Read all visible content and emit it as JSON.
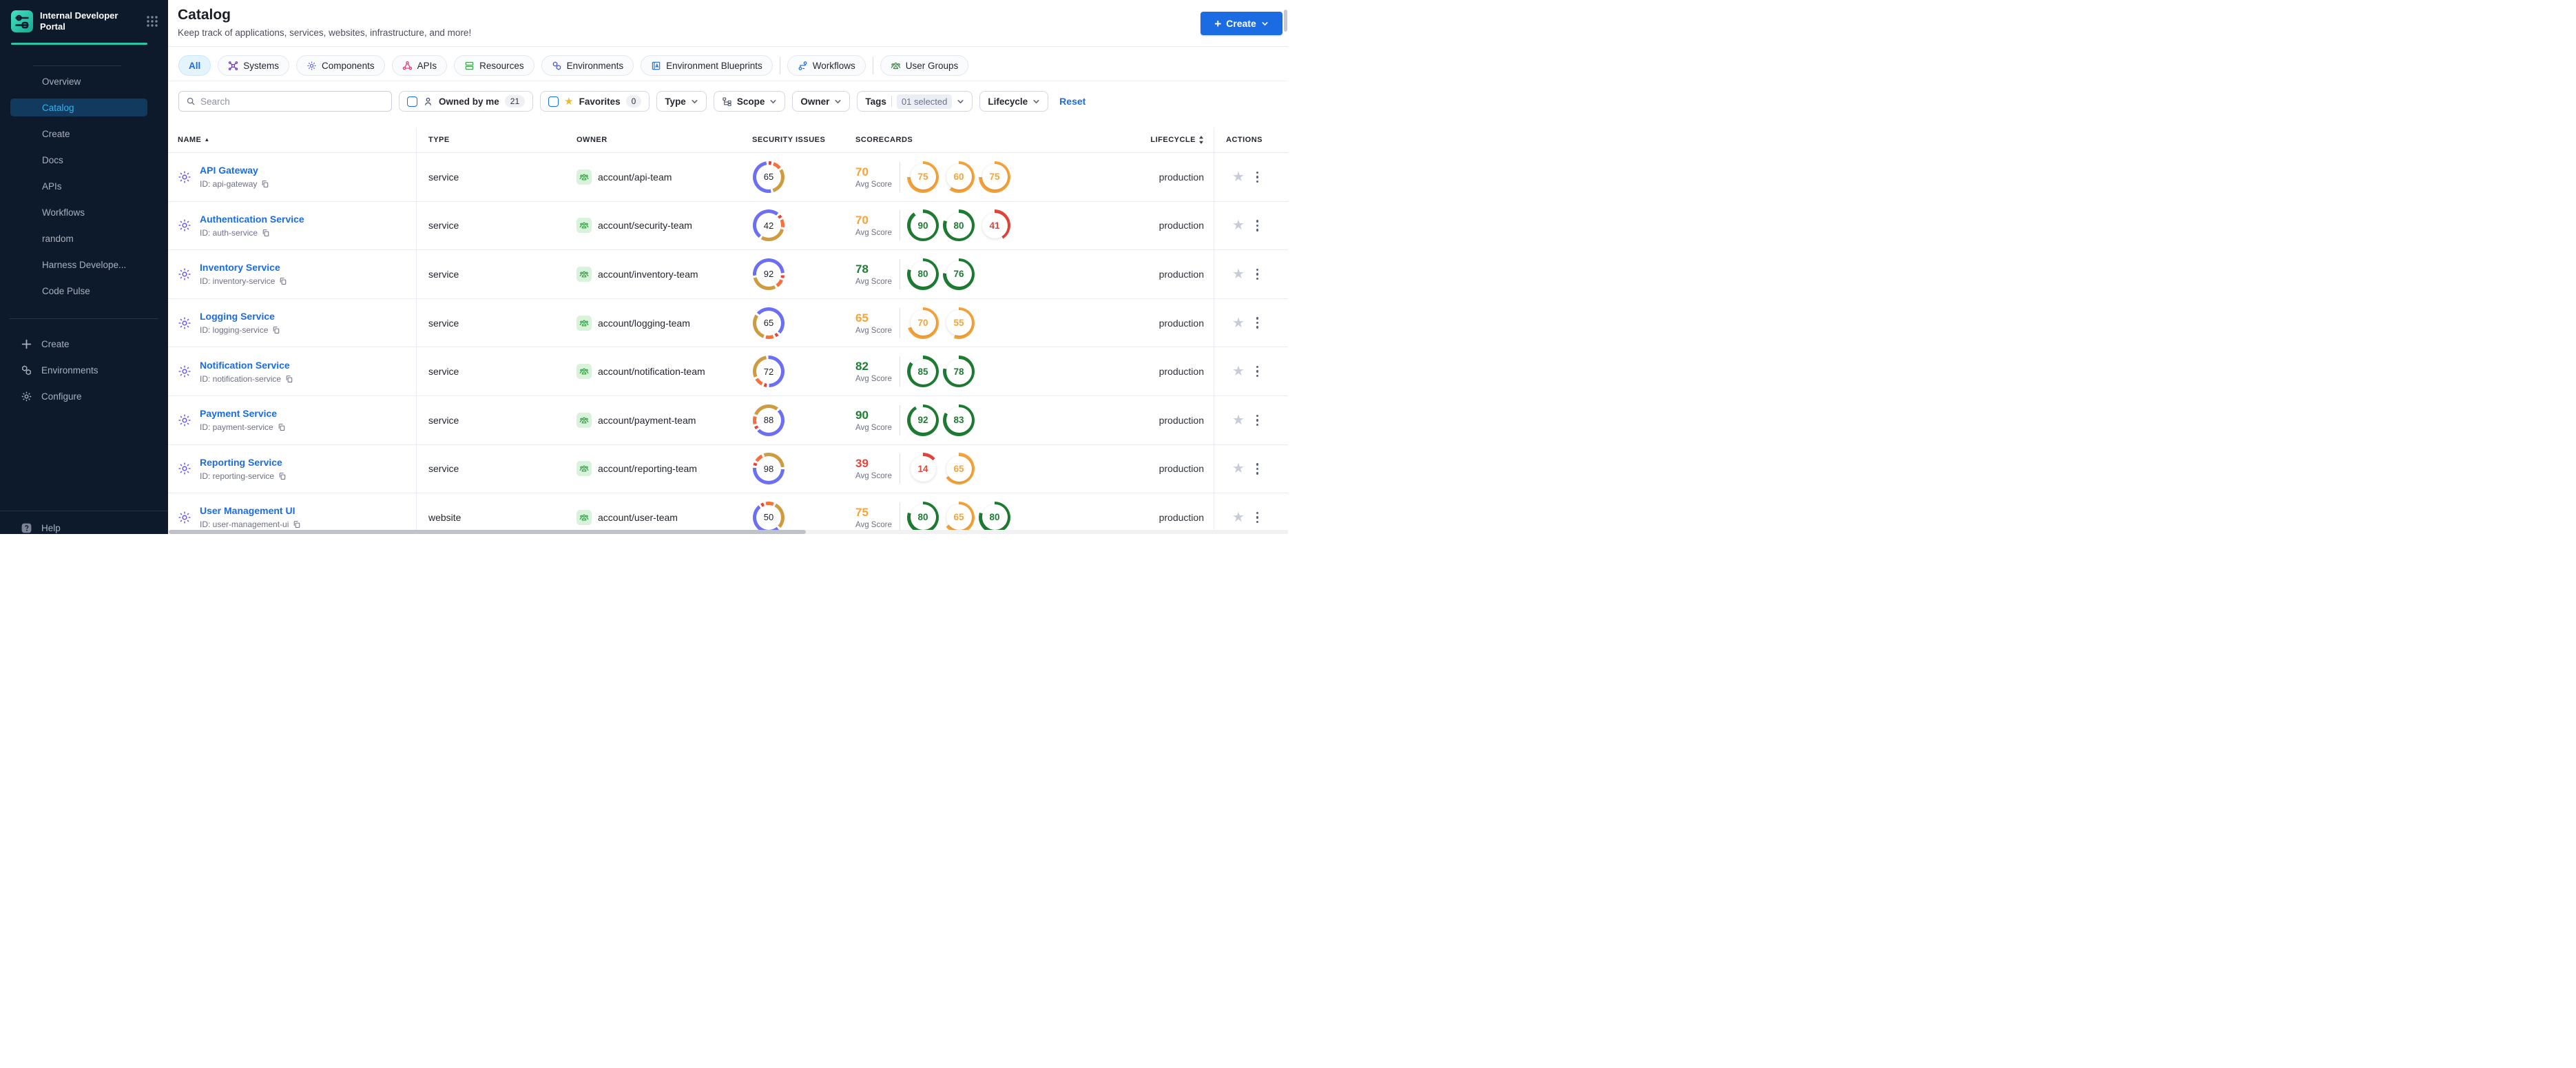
{
  "colors": {
    "accent_blue": "#1b6ce3",
    "teal": "#27c6a6",
    "green": "#1e7d33",
    "orange": "#f5a43b",
    "red": "#e2453c",
    "donut_segments": [
      "#e2453c",
      "#f8703c",
      "#cf9b3f",
      "#6c6ff2"
    ]
  },
  "sidebar": {
    "app_title_line1": "Internal Developer",
    "app_title_line2": "Portal",
    "items": [
      {
        "label": "Overview",
        "active": false
      },
      {
        "label": "Catalog",
        "active": true
      },
      {
        "label": "Create",
        "active": false
      },
      {
        "label": "Docs",
        "active": false
      },
      {
        "label": "APIs",
        "active": false
      },
      {
        "label": "Workflows",
        "active": false
      },
      {
        "label": "random",
        "active": false
      },
      {
        "label": "Harness Develope...",
        "active": false
      },
      {
        "label": "Code Pulse",
        "active": false
      }
    ],
    "bottom_items": [
      {
        "label": "Create",
        "icon": "plus-icon"
      },
      {
        "label": "Environments",
        "icon": "environments-icon"
      },
      {
        "label": "Configure",
        "icon": "gear-icon"
      }
    ],
    "help_label": "Help"
  },
  "header": {
    "title": "Catalog",
    "subtitle": "Keep track of applications, services, websites, infrastructure, and more!",
    "create_button_label": "Create"
  },
  "tabs": [
    {
      "label": "All",
      "icon": null,
      "color": "#1b6ce3",
      "active": true
    },
    {
      "label": "Systems",
      "icon": "systems-icon",
      "color": "#6a2fb5",
      "active": false
    },
    {
      "label": "Components",
      "icon": "components-icon",
      "color": "#5b5fe8",
      "active": false
    },
    {
      "label": "APIs",
      "icon": "apis-icon",
      "color": "#e0336b",
      "active": false
    },
    {
      "label": "Resources",
      "icon": "resources-icon",
      "color": "#3d9e4c",
      "active": false
    },
    {
      "label": "Environments",
      "icon": "environments-icon",
      "color": "#4653d8",
      "active": false
    },
    {
      "label": "Environment Blueprints",
      "icon": "blueprints-icon",
      "color": "#1b6ce3",
      "active": false,
      "divider_after": true
    },
    {
      "label": "Workflows",
      "icon": "workflows-icon",
      "color": "#1b6ce3",
      "active": false,
      "divider_after": true
    },
    {
      "label": "User Groups",
      "icon": "usergroups-icon",
      "color": "#2e7d36",
      "active": false
    }
  ],
  "filters": {
    "search_placeholder": "Search",
    "owned_by_me": {
      "label": "Owned by me",
      "count": "21",
      "checked": false
    },
    "favorites": {
      "label": "Favorites",
      "count": "0",
      "checked": false
    },
    "type_label": "Type",
    "scope_label": "Scope",
    "owner_label": "Owner",
    "tags_label": "Tags",
    "tags_value": "01 selected",
    "lifecycle_label": "Lifecycle",
    "reset_label": "Reset"
  },
  "table": {
    "columns": {
      "name": "NAME",
      "type": "TYPE",
      "owner": "OWNER",
      "security": "SECURITY ISSUES",
      "scorecards": "SCORECARDS",
      "lifecycle": "LIFECYCLE",
      "actions": "ACTIONS"
    },
    "avg_score_label": "Avg Score",
    "rows": [
      {
        "name": "API Gateway",
        "id_text": "ID: api-gateway",
        "type": "service",
        "owner": "account/api-team",
        "security_issues": 65,
        "avg_score": 70,
        "scorecards": [
          75,
          60,
          75
        ],
        "lifecycle": "production"
      },
      {
        "name": "Authentication Service",
        "id_text": "ID: auth-service",
        "type": "service",
        "owner": "account/security-team",
        "security_issues": 42,
        "avg_score": 70,
        "scorecards": [
          90,
          80,
          41
        ],
        "lifecycle": "production"
      },
      {
        "name": "Inventory Service",
        "id_text": "ID: inventory-service",
        "type": "service",
        "owner": "account/inventory-team",
        "security_issues": 92,
        "avg_score": 78,
        "scorecards": [
          80,
          76
        ],
        "lifecycle": "production"
      },
      {
        "name": "Logging Service",
        "id_text": "ID: logging-service",
        "type": "service",
        "owner": "account/logging-team",
        "security_issues": 65,
        "avg_score": 65,
        "scorecards": [
          70,
          55
        ],
        "lifecycle": "production"
      },
      {
        "name": "Notification Service",
        "id_text": "ID: notification-service",
        "type": "service",
        "owner": "account/notification-team",
        "security_issues": 72,
        "avg_score": 82,
        "scorecards": [
          85,
          78
        ],
        "lifecycle": "production"
      },
      {
        "name": "Payment Service",
        "id_text": "ID: payment-service",
        "type": "service",
        "owner": "account/payment-team",
        "security_issues": 88,
        "avg_score": 90,
        "scorecards": [
          92,
          83
        ],
        "lifecycle": "production"
      },
      {
        "name": "Reporting Service",
        "id_text": "ID: reporting-service",
        "type": "service",
        "owner": "account/reporting-team",
        "security_issues": 98,
        "avg_score": 39,
        "scorecards": [
          14,
          65
        ],
        "lifecycle": "production"
      },
      {
        "name": "User Management UI",
        "id_text": "ID: user-management-ui",
        "type": "website",
        "owner": "account/user-team",
        "security_issues": 50,
        "avg_score": 75,
        "scorecards": [
          80,
          65,
          80
        ],
        "lifecycle": "production"
      }
    ]
  }
}
